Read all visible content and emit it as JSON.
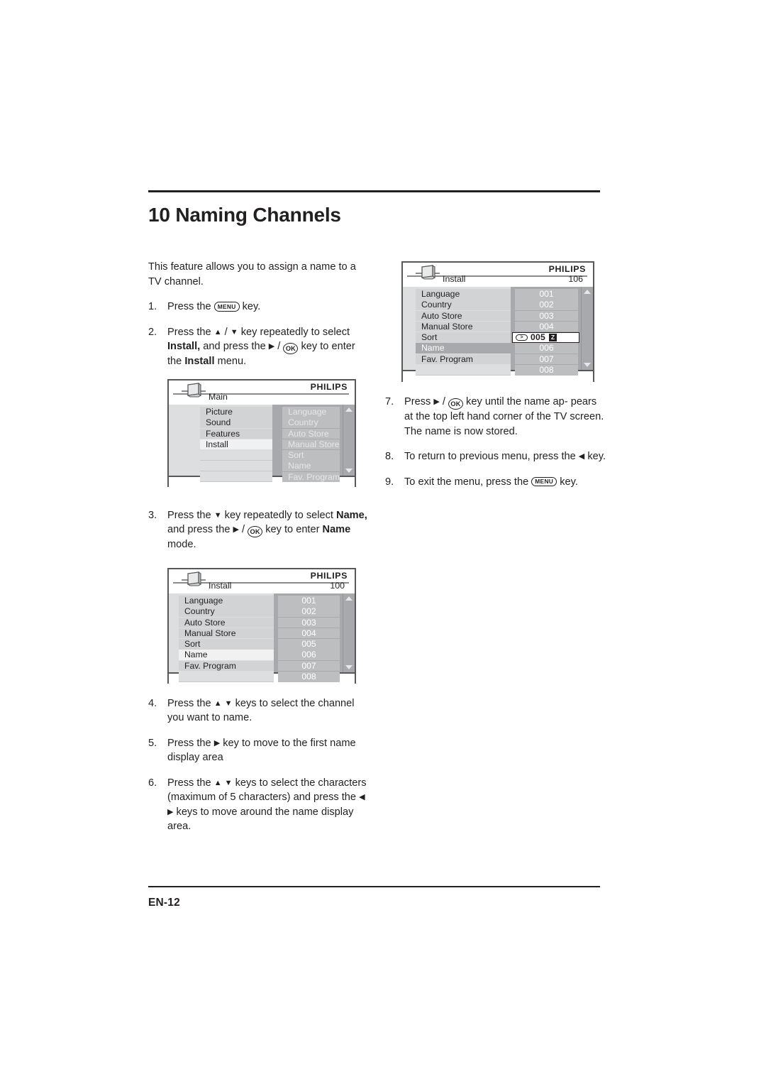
{
  "page": {
    "title": "10 Naming Channels",
    "page_number": "EN-12"
  },
  "intro": "This feature allows you to assign a name to a TV channel.",
  "steps": {
    "s1": {
      "num": "1.",
      "pre": "Press the ",
      "key": "MENU",
      "post": " key."
    },
    "s2": {
      "num": "2.",
      "line1_a": "Press the ",
      "line1_up": "▲",
      "line1_sep": " / ",
      "line1_dn": "▼",
      "line1_b": " key repeatedly to",
      "line2_a": "select ",
      "line2_bold": "Install,",
      "line2_b": "  and press the ",
      "line2_arrow": "▶",
      "line2_sep": " / ",
      "line2_key": "OK",
      "line2_c": " key",
      "line3_a": "to enter the ",
      "line3_bold": "Install",
      "line3_b": " menu."
    },
    "s3": {
      "num": "3.",
      "line1_a": "Press the ",
      "line1_dn": "▼",
      "line1_b": " key repeatedly to select",
      "line2_bold": "Name,",
      "line2_a": " and press the ",
      "line2_arrow": "▶",
      "line2_sep": " / ",
      "line2_key": "OK",
      "line2_b": " key to",
      "line3_a": "enter ",
      "line3_bold": "Name",
      "line3_b": " mode."
    },
    "s4": {
      "num": "4.",
      "a": "Press the ",
      "up": "▲",
      "gap": "  ",
      "dn": "▼",
      "b": " keys to select the channel you want to name."
    },
    "s5": {
      "num": "5.",
      "a": "Press the ",
      "arrow": "▶",
      "b": " key to move to the first name display area"
    },
    "s6": {
      "num": "6.",
      "l1_a": "Press the ",
      "l1_up": "▲",
      "l1_gap": "  ",
      "l1_dn": "▼",
      "l1_b": " keys to select the",
      "l2": "characters (maximum of 5 characters)",
      "l3_a": "and press the ",
      "l3_left": "◀",
      "l3_gap": "  ",
      "l3_right": "▶",
      "l3_b": " keys to move",
      "l4": "around the name display area."
    },
    "s7": {
      "num": "7.",
      "a": "Press  ",
      "arrow": "▶",
      "sep": " / ",
      "key": "OK",
      "b": " key until the name ap-pears at the top left hand corner of the TV screen. The name is now stored.",
      "line1_tail": " key until the name ap-",
      "line2": "pears at the top left hand corner of the",
      "line3": "TV screen. The name is now stored."
    },
    "s8": {
      "num": "8.",
      "line1": "To return to previous menu, press the",
      "line2_arrow": "◀",
      "line2_tail": " key."
    },
    "s9": {
      "num": "9.",
      "a": "To exit the menu, press the ",
      "key": "MENU",
      "b": " key."
    }
  },
  "tv_main": {
    "brand": "PHILIPS",
    "menu_label": "Main",
    "channel": "",
    "left_items": [
      "Picture",
      "Sound",
      "Features",
      "Install"
    ],
    "left_selected": "Install",
    "right_items": [
      "Language",
      "Country",
      "Auto Store",
      "Manual Store",
      "Sort",
      "Name",
      "Fav. Program"
    ],
    "scroll_up": "△",
    "scroll_down": "▽"
  },
  "tv_install": {
    "brand": "PHILIPS",
    "menu_label": "Install",
    "channel": "100",
    "left_items": [
      "Language",
      "Country",
      "Auto Store",
      "Manual Store",
      "Sort",
      "Name",
      "Fav. Program"
    ],
    "left_selected": "Name",
    "right_items": [
      "001",
      "002",
      "003",
      "004",
      "005",
      "006",
      "007",
      "008"
    ],
    "scroll_up": "△",
    "scroll_down": "▽"
  },
  "tv_name": {
    "brand": "PHILIPS",
    "menu_label": "Install",
    "channel": "106",
    "left_items": [
      "Language",
      "Country",
      "Auto Store",
      "Manual Store",
      "Sort",
      "Name",
      "Fav. Program"
    ],
    "left_selected": "Name",
    "right_items": [
      "001",
      "002",
      "003",
      "004",
      "005",
      "006",
      "007",
      "008"
    ],
    "highlight_index": 4,
    "highlight_number": "005",
    "highlight_pill": ">",
    "highlight_char": "Z",
    "scroll_up": "△",
    "scroll_down": "▽"
  },
  "colors": {
    "ink": "#231f20",
    "pane_left_bg": "#dddee0",
    "pane_right_bg": "#a7a9ac",
    "row_light": "#d2d3d5",
    "row_mid": "#bcbec0",
    "row_selected": "#f1f1f2",
    "border": "#58585b"
  }
}
